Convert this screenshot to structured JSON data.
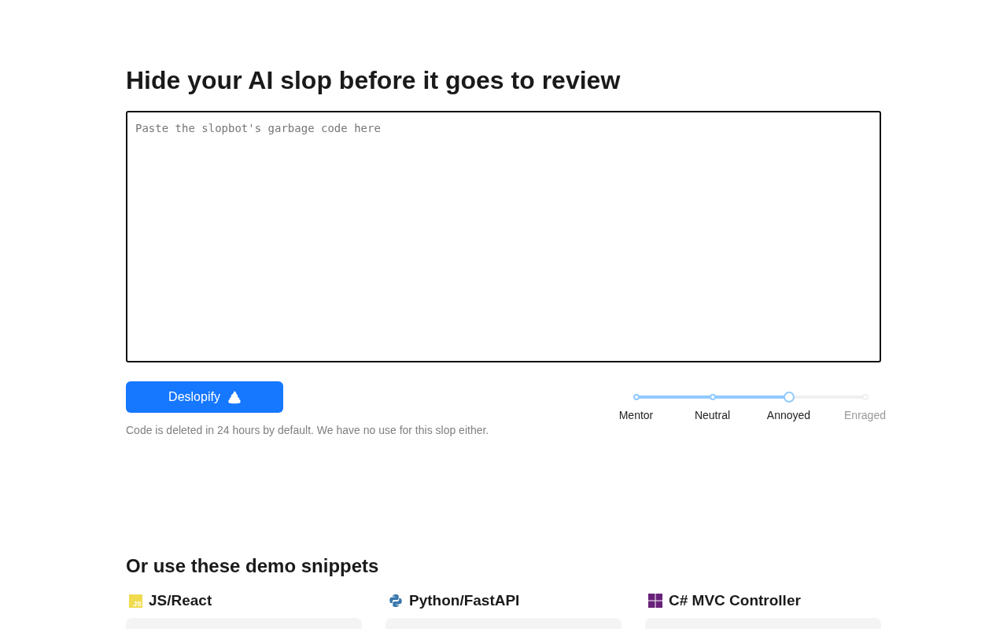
{
  "title": "Hide your AI slop before it goes to review",
  "editor": {
    "placeholder": "Paste the slopbot's garbage code here"
  },
  "button": {
    "label": "Deslopify"
  },
  "note": "Code is deleted in 24 hours by default. We have no use for this slop either.",
  "tone_slider": {
    "level": 0.667,
    "stops": [
      {
        "label": "Mentor",
        "selected": false
      },
      {
        "label": "Neutral",
        "selected": false
      },
      {
        "label": "Annoyed",
        "selected": true
      },
      {
        "label": "Enraged",
        "selected": false
      }
    ]
  },
  "demo_heading": "Or use these demo snippets",
  "snippets": [
    {
      "kind": "js",
      "badge": "JS",
      "label": "JS/React"
    },
    {
      "kind": "python",
      "label": "Python/FastAPI"
    },
    {
      "kind": "csharp",
      "label": "C# MVC Controller"
    }
  ]
}
